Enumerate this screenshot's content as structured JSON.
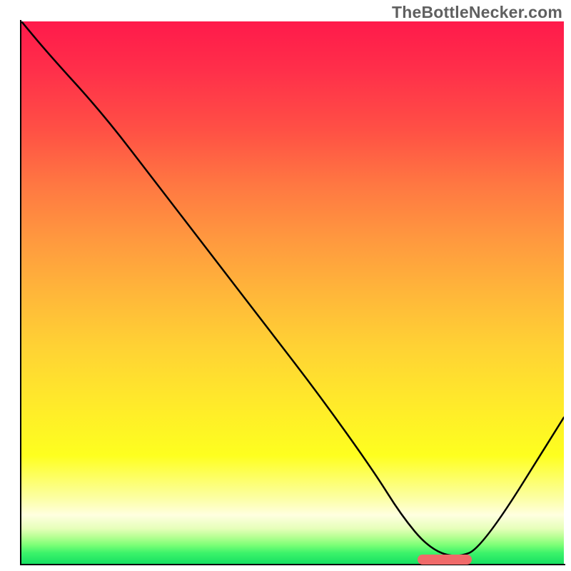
{
  "watermark_text": "TheBottleNecker.com",
  "plot": {
    "x_range": [
      0,
      100
    ],
    "y_range": [
      0,
      100
    ]
  },
  "chart_data": {
    "type": "line",
    "title": "",
    "xlabel": "",
    "ylabel": "",
    "xlim": [
      0,
      100
    ],
    "ylim": [
      0,
      100
    ],
    "x": [
      0,
      5,
      15,
      25,
      35,
      45,
      55,
      65,
      70,
      75,
      80,
      85,
      100
    ],
    "values": [
      100,
      94,
      83,
      70,
      57,
      44,
      31,
      17,
      9,
      3,
      1,
      3,
      27
    ],
    "marker": {
      "x_start": 73,
      "x_end": 83,
      "y": 0.8,
      "color": "#f06a6a"
    },
    "background_gradient_stops": [
      {
        "pos": 0,
        "color": "#ff1a4b"
      },
      {
        "pos": 0.5,
        "color": "#ffb63a"
      },
      {
        "pos": 0.8,
        "color": "#feff1f"
      },
      {
        "pos": 0.95,
        "color": "#b8ff94"
      },
      {
        "pos": 1.0,
        "color": "#17e062"
      }
    ]
  }
}
